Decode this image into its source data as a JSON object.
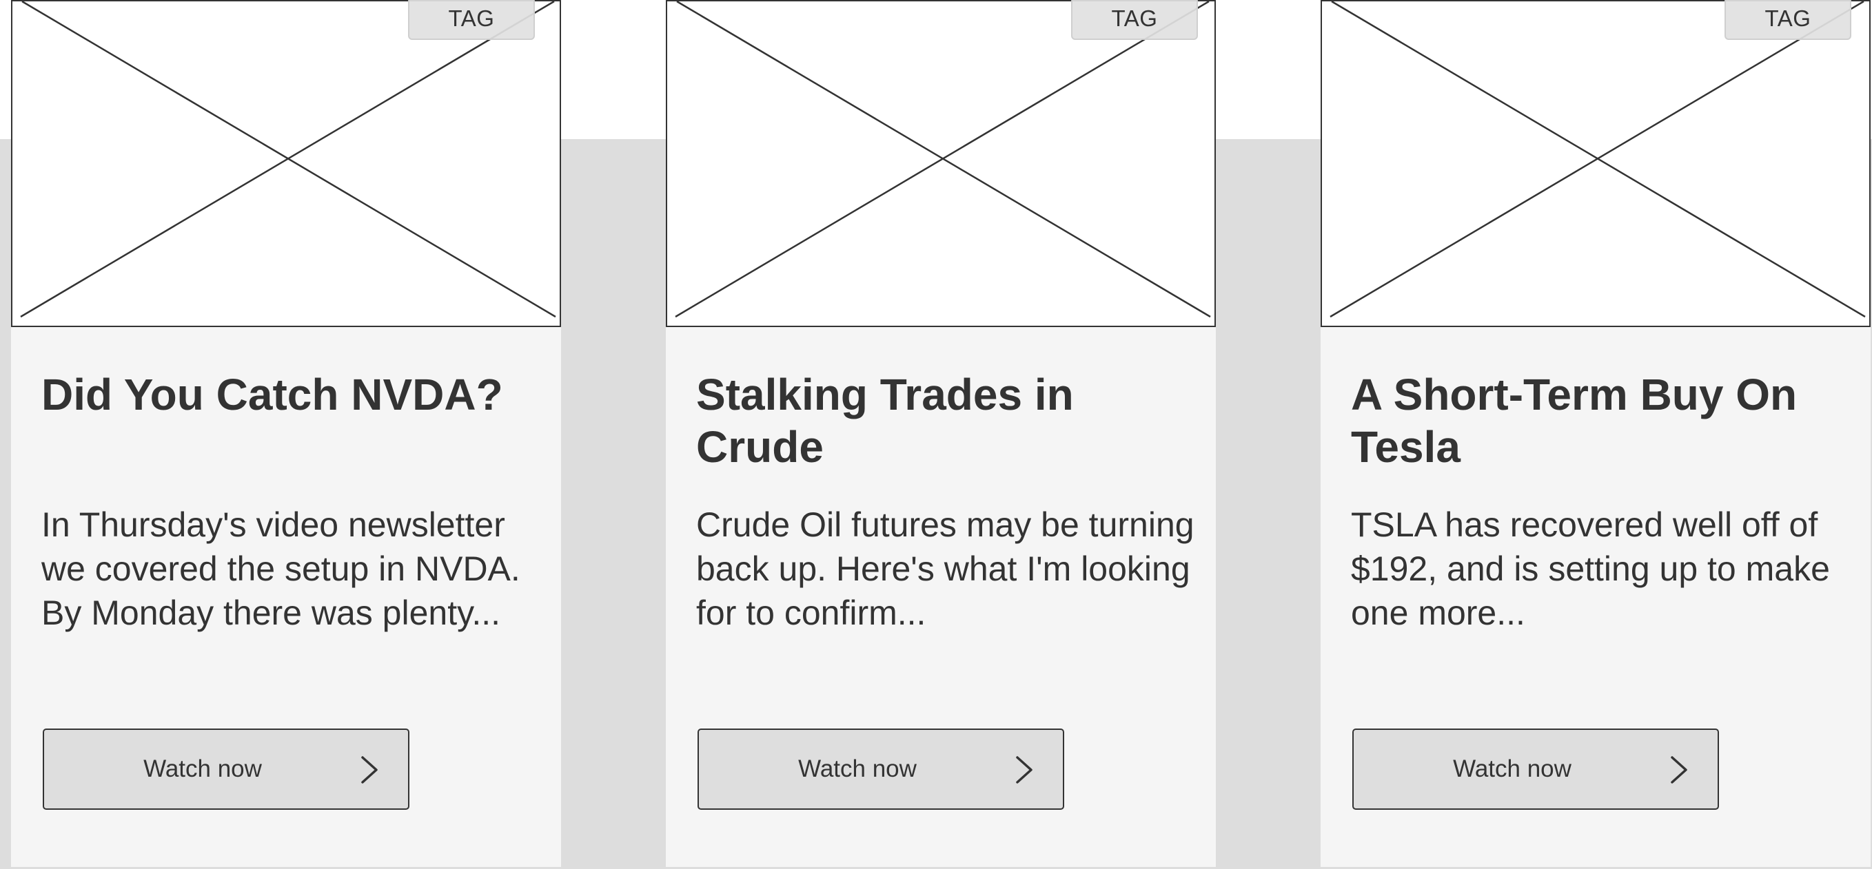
{
  "cards": [
    {
      "tag": "TAG",
      "title": "Did You Catch NVDA?",
      "description": "In Thursday's video newsletter we covered the setup in NVDA. By Monday there was plenty...",
      "button_label": "Watch now"
    },
    {
      "tag": "TAG",
      "title": "Stalking Trades in Crude",
      "description": "Crude Oil futures may be turning back up. Here's what I'm looking for to confirm...",
      "button_label": "Watch now"
    },
    {
      "tag": "TAG",
      "title": "A Short-Term Buy On Tesla",
      "description": "TSLA has recovered well off of $192, and is setting up to make one more...",
      "button_label": "Watch now"
    }
  ],
  "icons": {
    "media": "image-placeholder-icon",
    "button": "chevron-right-icon"
  },
  "colors": {
    "page_background": "#ffffff",
    "band_background": "#dddddd",
    "card_background": "#f5f5f5",
    "button_background": "#dedede",
    "tag_background": "#e1e1e1",
    "text": "#333333"
  }
}
